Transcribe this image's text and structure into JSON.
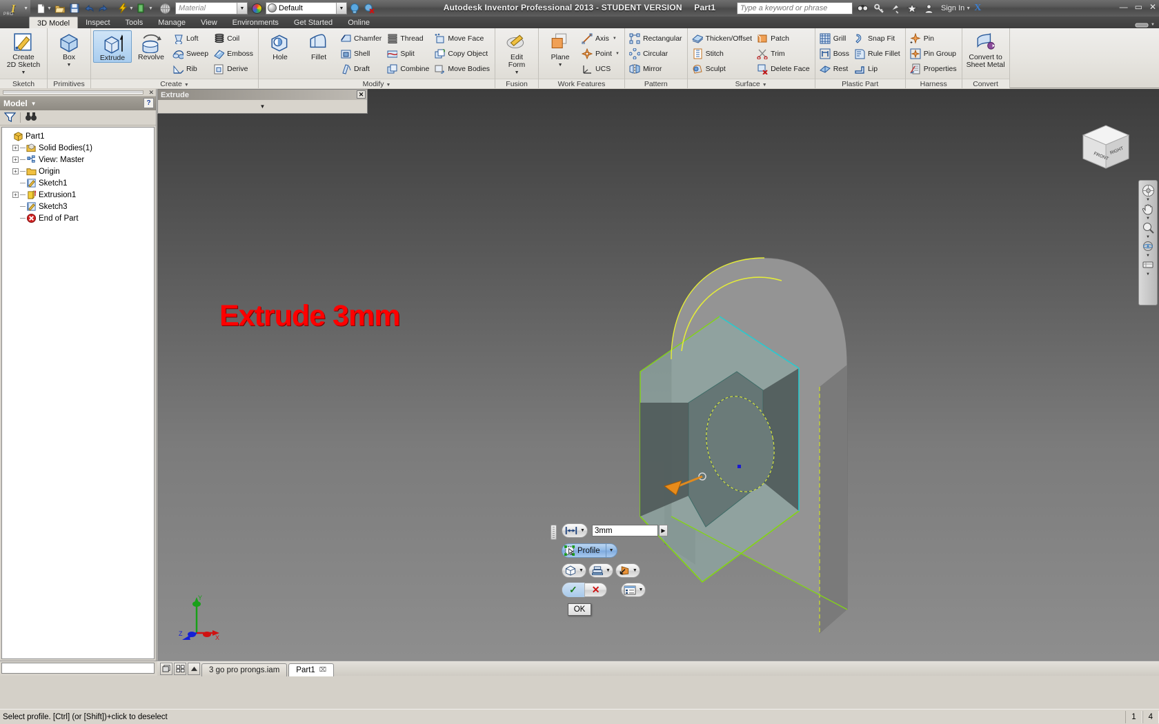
{
  "titlebar": {
    "app_title": "Autodesk Inventor Professional 2013 - STUDENT VERSION",
    "document_name": "Part1",
    "search_placeholder": "Type a keyword or phrase",
    "signin_label": "Sign In",
    "material_placeholder": "Material",
    "appearance_value": "Default",
    "logo_text": "I",
    "logo_sub": "PRO",
    "minimize": "—",
    "maximize": "▭",
    "close": "✕",
    "xi_label": "X"
  },
  "ribbon_tabs": [
    {
      "label": "3D Model",
      "active": true
    },
    {
      "label": "Inspect",
      "active": false
    },
    {
      "label": "Tools",
      "active": false
    },
    {
      "label": "Manage",
      "active": false
    },
    {
      "label": "View",
      "active": false
    },
    {
      "label": "Environments",
      "active": false
    },
    {
      "label": "Get Started",
      "active": false
    },
    {
      "label": "Online",
      "active": false
    }
  ],
  "ribbon_panels": [
    {
      "title": "Sketch",
      "big": [
        {
          "label": "Create\n2D Sketch",
          "icon": "create-2d-sketch-icon",
          "dropdown": true,
          "selected": false
        }
      ],
      "small": []
    },
    {
      "title": "Primitives",
      "big": [
        {
          "label": "Box",
          "icon": "box-icon",
          "dropdown": true,
          "selected": false
        }
      ],
      "small": []
    },
    {
      "title": "Create",
      "panel_dropdown": true,
      "big": [
        {
          "label": "Extrude",
          "icon": "extrude-icon",
          "dropdown": false,
          "selected": true
        },
        {
          "label": "Revolve",
          "icon": "revolve-icon",
          "dropdown": false,
          "selected": false
        }
      ],
      "small": [
        [
          {
            "label": "Loft",
            "icon": "loft-icon"
          },
          {
            "label": "Sweep",
            "icon": "sweep-icon"
          },
          {
            "label": "Rib",
            "icon": "rib-icon"
          }
        ],
        [
          {
            "label": "Coil",
            "icon": "coil-icon"
          },
          {
            "label": "Emboss",
            "icon": "emboss-icon"
          },
          {
            "label": "Derive",
            "icon": "derive-icon"
          }
        ]
      ]
    },
    {
      "title": "Modify",
      "panel_dropdown": true,
      "big": [
        {
          "label": "Hole",
          "icon": "hole-icon",
          "dropdown": false,
          "selected": false
        },
        {
          "label": "Fillet",
          "icon": "fillet-icon",
          "dropdown": false,
          "selected": false
        }
      ],
      "small": [
        [
          {
            "label": "Chamfer",
            "icon": "chamfer-icon"
          },
          {
            "label": "Shell",
            "icon": "shell-icon"
          },
          {
            "label": "Draft",
            "icon": "draft-icon"
          }
        ],
        [
          {
            "label": "Thread",
            "icon": "thread-icon"
          },
          {
            "label": "Split",
            "icon": "split-icon"
          },
          {
            "label": "Combine",
            "icon": "combine-icon"
          }
        ],
        [
          {
            "label": "Move Face",
            "icon": "move-face-icon"
          },
          {
            "label": "Copy Object",
            "icon": "copy-object-icon"
          },
          {
            "label": "Move Bodies",
            "icon": "move-bodies-icon"
          }
        ]
      ]
    },
    {
      "title": "Fusion",
      "big": [
        {
          "label": "Edit\nForm",
          "icon": "edit-form-icon",
          "dropdown": true,
          "selected": false
        }
      ],
      "small": []
    },
    {
      "title": "Work Features",
      "big": [
        {
          "label": "Plane",
          "icon": "plane-icon",
          "dropdown": true,
          "selected": false
        }
      ],
      "small": [
        [
          {
            "label": "Axis",
            "icon": "axis-icon",
            "dropdown": true
          },
          {
            "label": "Point",
            "icon": "point-icon",
            "dropdown": true
          },
          {
            "label": "UCS",
            "icon": "ucs-icon"
          }
        ]
      ]
    },
    {
      "title": "Pattern",
      "big": [],
      "small": [
        [
          {
            "label": "Rectangular",
            "icon": "rectangular-pattern-icon"
          },
          {
            "label": "Circular",
            "icon": "circular-pattern-icon"
          },
          {
            "label": "Mirror",
            "icon": "mirror-icon"
          }
        ]
      ]
    },
    {
      "title": "Surface",
      "panel_dropdown": true,
      "big": [],
      "small": [
        [
          {
            "label": "Thicken/Offset",
            "icon": "thicken-offset-icon"
          },
          {
            "label": "Stitch",
            "icon": "stitch-icon"
          },
          {
            "label": "Sculpt",
            "icon": "sculpt-icon"
          }
        ],
        [
          {
            "label": "Patch",
            "icon": "patch-icon"
          },
          {
            "label": "Trim",
            "icon": "trim-icon"
          },
          {
            "label": "Delete Face",
            "icon": "delete-face-icon"
          }
        ]
      ]
    },
    {
      "title": "Plastic Part",
      "big": [],
      "small": [
        [
          {
            "label": "Grill",
            "icon": "grill-icon"
          },
          {
            "label": "Boss",
            "icon": "boss-icon"
          },
          {
            "label": "Rest",
            "icon": "rest-icon"
          }
        ],
        [
          {
            "label": "Snap Fit",
            "icon": "snap-fit-icon"
          },
          {
            "label": "Rule Fillet",
            "icon": "rule-fillet-icon"
          },
          {
            "label": "Lip",
            "icon": "lip-icon"
          }
        ]
      ]
    },
    {
      "title": "Harness",
      "big": [],
      "small": [
        [
          {
            "label": "Pin",
            "icon": "pin-icon"
          },
          {
            "label": "Pin Group",
            "icon": "pin-group-icon"
          },
          {
            "label": "Properties",
            "icon": "properties-icon"
          }
        ]
      ]
    },
    {
      "title": "Convert",
      "big": [
        {
          "label": "Convert to\nSheet Metal",
          "icon": "convert-sheet-metal-icon",
          "dropdown": false,
          "selected": false
        }
      ],
      "small": []
    }
  ],
  "browser": {
    "title": "Model",
    "help_label": "?",
    "tree": [
      {
        "label": "Part1",
        "icon": "part-icon",
        "depth": 0,
        "expandable": false
      },
      {
        "label": "Solid Bodies(1)",
        "icon": "solid-bodies-icon",
        "depth": 1,
        "expandable": true
      },
      {
        "label": "View: Master",
        "icon": "view-master-icon",
        "depth": 1,
        "expandable": true
      },
      {
        "label": "Origin",
        "icon": "folder-icon",
        "depth": 1,
        "expandable": true
      },
      {
        "label": "Sketch1",
        "icon": "sketch-icon",
        "depth": 1,
        "expandable": false
      },
      {
        "label": "Extrusion1",
        "icon": "extrusion-icon",
        "depth": 1,
        "expandable": true
      },
      {
        "label": "Sketch3",
        "icon": "sketch-icon",
        "depth": 1,
        "expandable": false
      },
      {
        "label": "End of Part",
        "icon": "end-of-part-icon",
        "depth": 1,
        "expandable": false
      }
    ]
  },
  "extrude_panel": {
    "title": "Extrude",
    "close_label": "✕",
    "expand_label": "▼"
  },
  "viewport": {
    "annotation_text": "Extrude 3mm",
    "annotation_color": "#ff0000",
    "viewcube_faces": {
      "front": "FRONT",
      "right": "RIGHT"
    },
    "triad_labels": {
      "x": "X",
      "y": "Y",
      "z": "Z"
    }
  },
  "mini_toolbar": {
    "distance_value": "3mm",
    "distance_icon": "extent-distance-icon",
    "profile_label": "Profile",
    "profile_icon": "profile-select-icon",
    "solid_icon": "solid-output-icon",
    "boolean_icon": "join-boolean-icon",
    "direction_icon": "direction-flip-icon",
    "ok_check": "✓",
    "cancel_x": "✕",
    "options_icon": "more-options-icon",
    "ok_tooltip": "OK"
  },
  "doc_tabs": [
    {
      "label": "3 go pro prongs.iam",
      "active": false,
      "closable": false
    },
    {
      "label": "Part1",
      "active": true,
      "closable": true,
      "close_glyph": "⌧"
    }
  ],
  "statusbar": {
    "message": "Select profile. [Ctrl] (or [Shift])+click to deselect",
    "cell1": "1",
    "cell2": "4"
  }
}
